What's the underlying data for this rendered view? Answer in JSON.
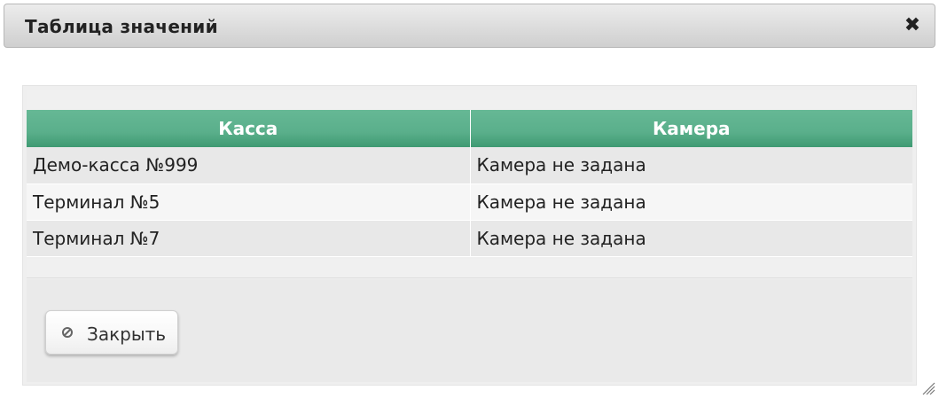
{
  "dialog": {
    "title": "Таблица значений",
    "close_icon": "close-icon"
  },
  "table": {
    "columns": [
      "Касса",
      "Камера"
    ],
    "rows": [
      [
        "Демо-касса №999",
        "Камера не задана"
      ],
      [
        "Терминал №5",
        "Камера не задана"
      ],
      [
        "Терминал №7",
        "Камера не задана"
      ]
    ]
  },
  "footer": {
    "close_button_label": "Закрыть",
    "close_button_icon": "cancel-icon"
  },
  "colors": {
    "header_green": "#5aaf8b",
    "titlebar_gray": "#dcdcdc"
  }
}
